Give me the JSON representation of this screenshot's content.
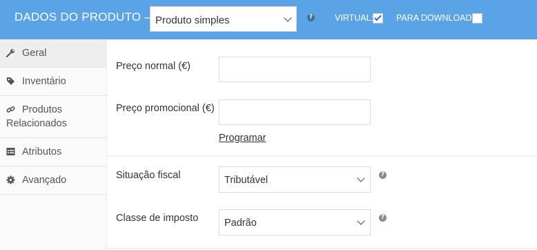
{
  "header": {
    "title": "DADOS DO PRODUTO —",
    "product_type": "Produto simples",
    "help_icon": "?",
    "virtual_label": "VIRTUAL:",
    "virtual_checked": true,
    "download_label": "PARA DOWNLOAD:",
    "download_checked": false
  },
  "sidebar": {
    "items": [
      {
        "label": "Geral",
        "icon": "wrench-icon",
        "active": true
      },
      {
        "label": "Inventário",
        "icon": "tag-icon",
        "active": false
      },
      {
        "label": "Produtos Relacionados",
        "icon": "link-icon",
        "active": false
      },
      {
        "label": "Atributos",
        "icon": "list-table-icon",
        "active": false
      },
      {
        "label": "Avançado",
        "icon": "gear-icon",
        "active": false
      }
    ]
  },
  "pricing": {
    "regular_price_label": "Preço normal (€)",
    "regular_price_value": "",
    "sale_price_label": "Preço promocional (€)",
    "sale_price_value": "",
    "schedule_link": "Programar"
  },
  "tax": {
    "status_label": "Situação fiscal",
    "status_value": "Tributável",
    "class_label": "Classe de imposto",
    "class_value": "Padrão",
    "help_icon": "?"
  },
  "colors": {
    "header_bg": "#5aa3e6",
    "checkbox_tick": "#1e6fd0",
    "sidebar_active_bg": "#eeeeee"
  }
}
